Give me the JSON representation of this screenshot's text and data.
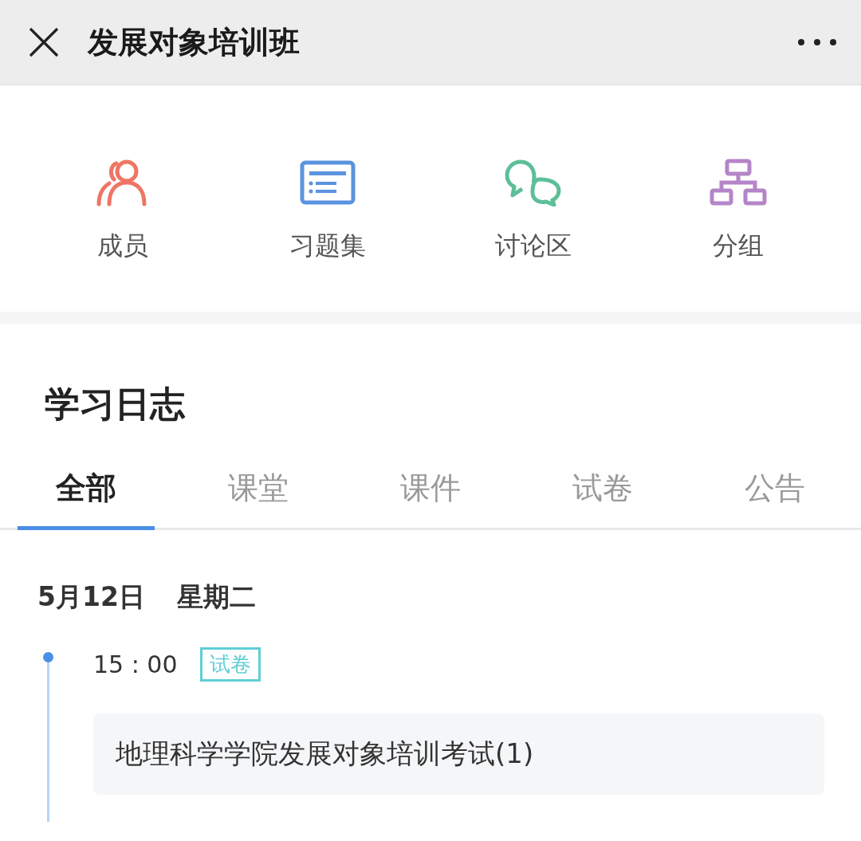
{
  "header": {
    "title": "发展对象培训班"
  },
  "shortcuts": [
    {
      "kind": "members",
      "label": "成员",
      "color": "#ef7565"
    },
    {
      "kind": "exercises",
      "label": "习题集",
      "color": "#5b93e0"
    },
    {
      "kind": "discussion",
      "label": "讨论区",
      "color": "#5cbf98"
    },
    {
      "kind": "groups",
      "label": "分组",
      "color": "#b585c8"
    }
  ],
  "log": {
    "title": "学习日志",
    "tabs": [
      {
        "label": "全部",
        "selected": true
      },
      {
        "label": "课堂",
        "selected": false
      },
      {
        "label": "课件",
        "selected": false
      },
      {
        "label": "试卷",
        "selected": false
      },
      {
        "label": "公告",
        "selected": false
      }
    ],
    "days": [
      {
        "date": "5月12日",
        "weekday": "星期二",
        "entries": [
          {
            "time": "15 : 00",
            "tag": "试卷",
            "title": "地理科学学院发展对象培训考试(1)"
          }
        ]
      }
    ]
  }
}
